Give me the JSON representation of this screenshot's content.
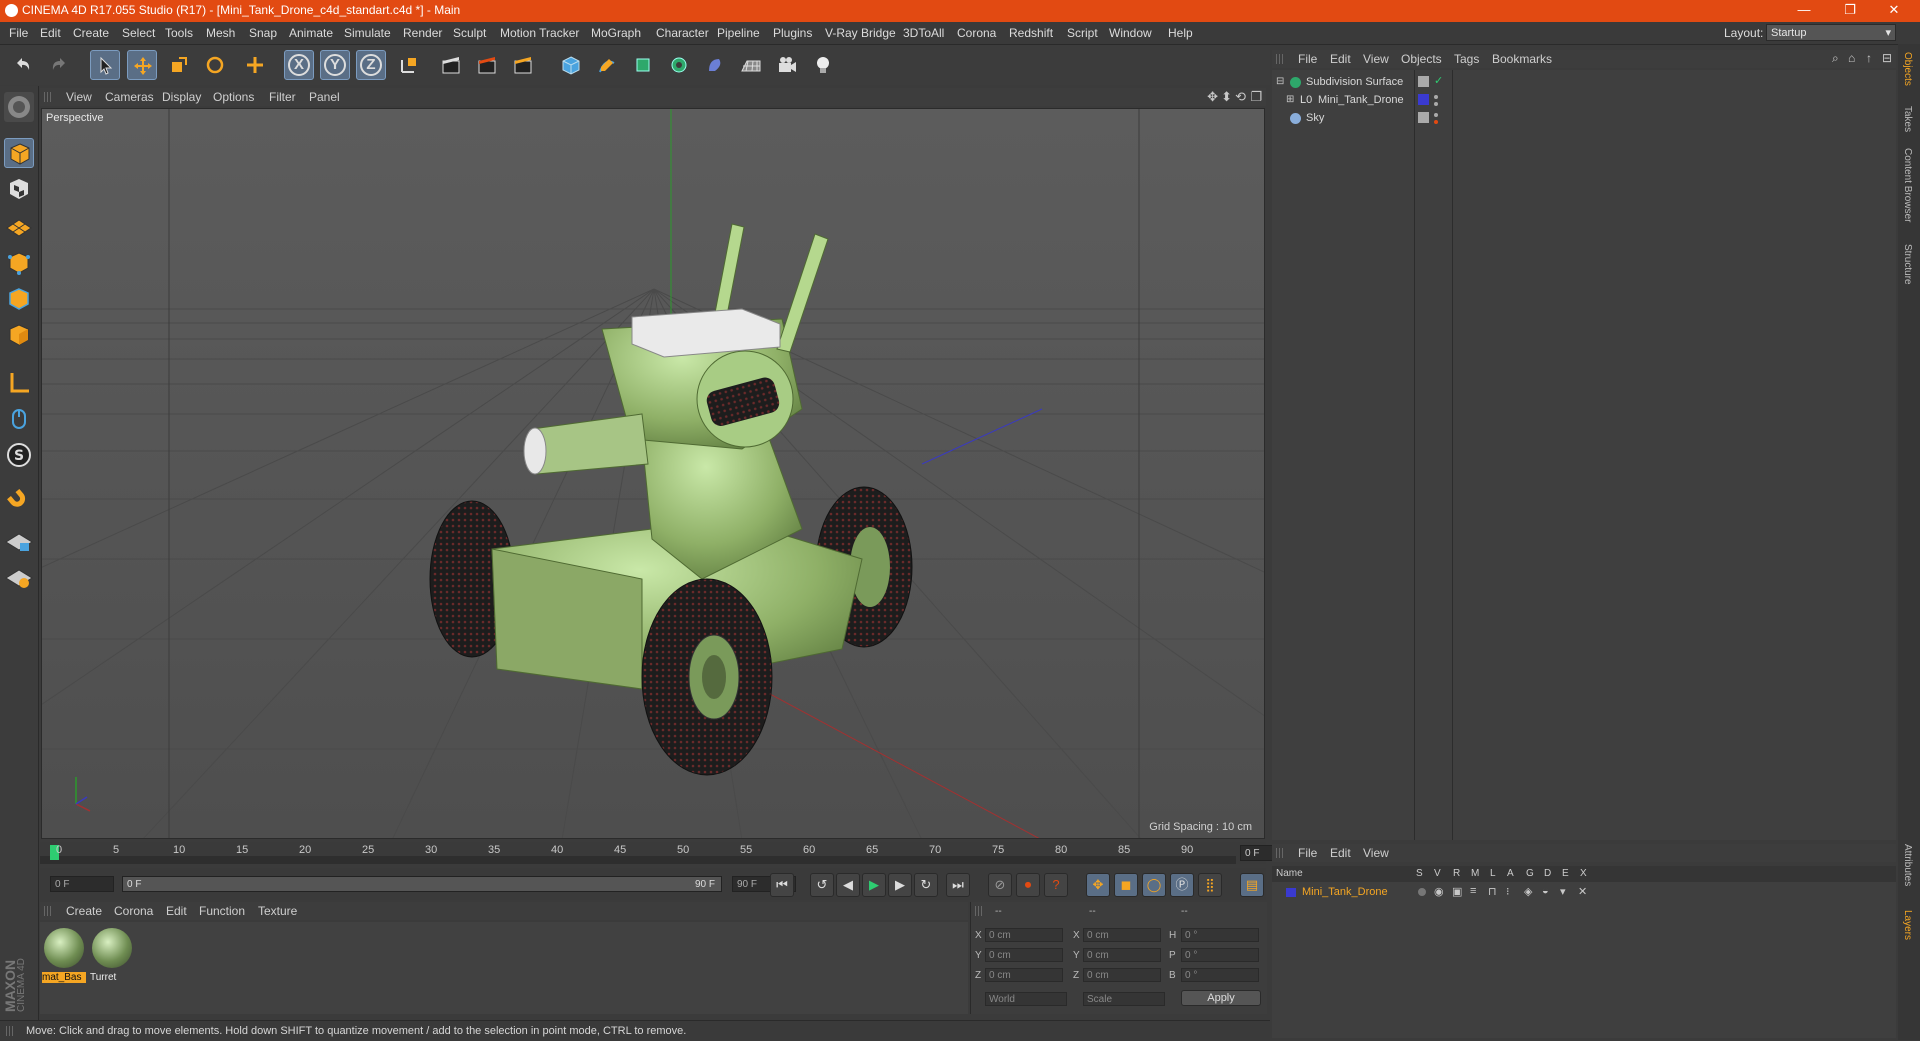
{
  "window": {
    "title": "CINEMA 4D R17.055 Studio (R17) - [Mini_Tank_Drone_c4d_standart.c4d *] - Main",
    "controls": [
      "—",
      "❐",
      "✕"
    ]
  },
  "menubar": {
    "items": [
      "File",
      "Edit",
      "Create",
      "Select",
      "Tools",
      "Mesh",
      "Snap",
      "Animate",
      "Simulate",
      "Render",
      "Sculpt",
      "Motion Tracker",
      "MoGraph",
      "Character",
      "Pipeline",
      "Plugins",
      "V-Ray Bridge",
      "3DToAll",
      "Corona",
      "Redshift",
      "Script",
      "Window",
      "Help"
    ],
    "layout_label": "Layout:",
    "layout_value": "Startup"
  },
  "toolbar": {
    "axis_x": "X",
    "axis_y": "Y",
    "axis_z": "Z"
  },
  "viewport": {
    "menu": [
      "View",
      "Cameras",
      "Display",
      "Options",
      "Filter",
      "Panel"
    ],
    "label": "Perspective",
    "grid_spacing": "Grid Spacing : 10 cm"
  },
  "timeline": {
    "ticks": [
      "0",
      "5",
      "10",
      "15",
      "20",
      "25",
      "30",
      "35",
      "40",
      "45",
      "50",
      "55",
      "60",
      "65",
      "70",
      "75",
      "80",
      "85",
      "90"
    ],
    "frame_display": "0 F"
  },
  "transport": {
    "start_field": "0 F",
    "range_start": "0 F",
    "range_end": "90 F",
    "end_field": "90 F"
  },
  "material_manager": {
    "menu": [
      "Create",
      "Corona",
      "Edit",
      "Function",
      "Texture"
    ],
    "materials": [
      {
        "name": "mat_Bas",
        "selected": true
      },
      {
        "name": "Turret",
        "selected": false
      }
    ],
    "brand_top": "MAXON",
    "brand_bottom": "CINEMA 4D"
  },
  "coordinates": {
    "header": [
      "--",
      "--",
      "--"
    ],
    "rows": [
      {
        "a": "X",
        "av": "0 cm",
        "b": "X",
        "bv": "0 cm",
        "c": "H",
        "cv": "0 °"
      },
      {
        "a": "Y",
        "av": "0 cm",
        "b": "Y",
        "bv": "0 cm",
        "c": "P",
        "cv": "0 °"
      },
      {
        "a": "Z",
        "av": "0 cm",
        "b": "Z",
        "bv": "0 cm",
        "c": "B",
        "cv": "0 °"
      }
    ],
    "mode": "World",
    "scale": "Scale",
    "apply": "Apply"
  },
  "status": {
    "text": "Move: Click and drag to move elements. Hold down SHIFT to quantize movement / add to the selection in point mode, CTRL to remove."
  },
  "object_manager": {
    "menu": [
      "File",
      "Edit",
      "View",
      "Objects",
      "Tags",
      "Bookmarks"
    ],
    "objects": [
      {
        "name": "Subdivision Surface"
      },
      {
        "name": "Mini_Tank_Drone"
      },
      {
        "name": "Sky"
      }
    ]
  },
  "layer_manager": {
    "menu": [
      "File",
      "Edit",
      "View"
    ],
    "columns": [
      "Name",
      "S",
      "V",
      "R",
      "M",
      "L",
      "A",
      "G",
      "D",
      "E",
      "X"
    ],
    "layers": [
      {
        "name": "Mini_Tank_Drone",
        "color": "#3a3ad0"
      }
    ]
  },
  "right_tabs": [
    "Objects",
    "Takes",
    "Content Browser",
    "Structure",
    "Attributes",
    "Layers"
  ],
  "colors": {
    "titlebar": "#e24a12",
    "accent": "#f5a623",
    "selection": "#5a6e86"
  }
}
